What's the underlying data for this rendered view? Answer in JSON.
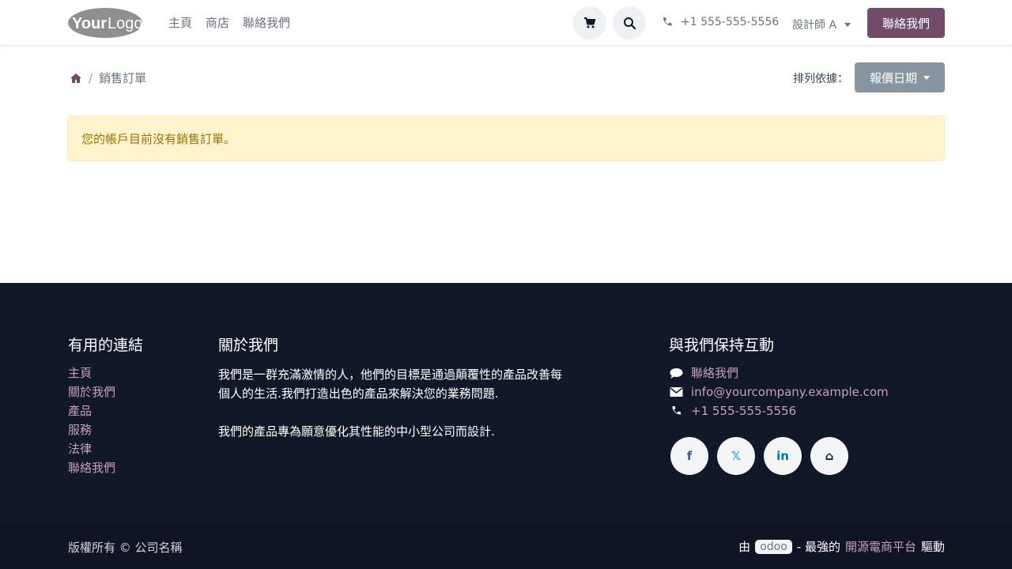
{
  "header": {
    "logo_text": "YourLogo",
    "nav": [
      {
        "label": "主頁"
      },
      {
        "label": "商店"
      },
      {
        "label": "聯絡我們"
      }
    ],
    "phone": "+1 555-555-5556",
    "designer_label": "設計師 A",
    "contact_button": "聯絡我們",
    "icons": {
      "cart": "cart-icon",
      "search": "search-icon",
      "phone": "phone-icon"
    }
  },
  "breadcrumb": {
    "home_icon": "home-icon",
    "current": "銷售訂單"
  },
  "sort": {
    "label": "排列依據：",
    "value": "報價日期"
  },
  "alert": {
    "message": "您的帳戶目前沒有銷售訂單。"
  },
  "footer": {
    "links": {
      "title": "有用的連結",
      "items": [
        {
          "label": "主頁"
        },
        {
          "label": "關於我們"
        },
        {
          "label": "產品"
        },
        {
          "label": "服務"
        },
        {
          "label": "法律"
        },
        {
          "label": "聯絡我們"
        }
      ]
    },
    "about": {
      "title": "關於我們",
      "p1": "我們是一群充滿激情的人，他們的目標是通過顛覆性的產品改善每個人的生活.我們打造出色的產品來解決您的業務問題.",
      "p2": "我們的產品專為願意優化其性能的中小型公司而設計."
    },
    "contact": {
      "title": "與我們保持互動",
      "chat": "聯絡我們",
      "email": "info@yourcompany.example.com",
      "phone": "+1 555-555-5556"
    },
    "socials": [
      {
        "icon": "facebook-icon",
        "glyph": "f"
      },
      {
        "icon": "x-icon",
        "glyph": "𝕏"
      },
      {
        "icon": "linkedin-icon",
        "glyph": "in"
      },
      {
        "icon": "home-icon",
        "glyph": "⌂"
      }
    ]
  },
  "bottom": {
    "copyright": "版權所有 © 公司名稱",
    "powered_by": "由",
    "odoo": "odoo",
    "dash": "- 最強的",
    "link": "開源電商平台",
    "suffix": "驅動"
  },
  "colors": {
    "primary": "#714b67",
    "footer_bg": "#111827",
    "alert_bg": "#fff3cd",
    "link": "#c79fbd"
  }
}
